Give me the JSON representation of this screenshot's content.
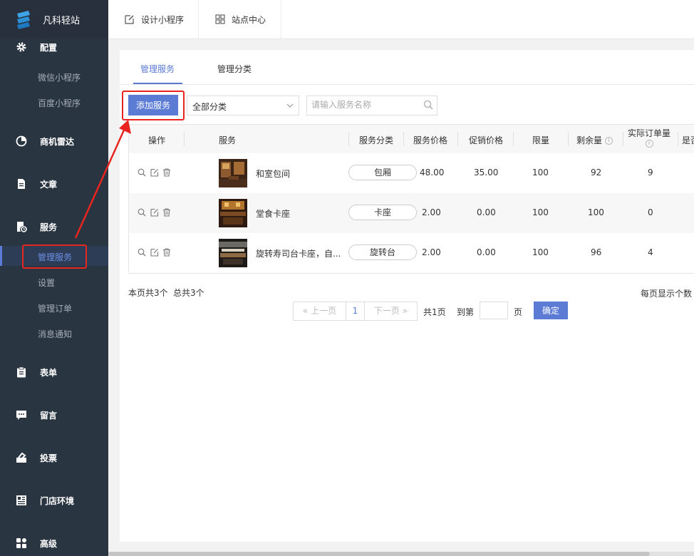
{
  "app": {
    "name": "凡科轻站"
  },
  "colors": {
    "sidebar_bg": "#2a3542",
    "accent": "#5b7bd5",
    "highlight": "#e8251f"
  },
  "sidebar": {
    "items": [
      {
        "label": "配置",
        "icon": "gear-icon"
      },
      {
        "label": "微信小程序"
      },
      {
        "label": "百度小程序"
      },
      {
        "label": "商机雷达",
        "icon": "radar-icon"
      },
      {
        "label": "文章",
        "icon": "document-icon"
      },
      {
        "label": "服务",
        "icon": "service-icon"
      },
      {
        "label": "管理服务",
        "active": true
      },
      {
        "label": "设置"
      },
      {
        "label": "管理订单"
      },
      {
        "label": "消息通知"
      },
      {
        "label": "表单",
        "icon": "clipboard-icon"
      },
      {
        "label": "留言",
        "icon": "message-icon"
      },
      {
        "label": "投票",
        "icon": "vote-icon"
      },
      {
        "label": "门店环境",
        "icon": "store-icon"
      },
      {
        "label": "高级",
        "icon": "grid-icon"
      }
    ]
  },
  "topbar": {
    "tabs": [
      {
        "label": "设计小程序",
        "icon": "edit-icon"
      },
      {
        "label": "站点中心",
        "icon": "apps-icon"
      }
    ]
  },
  "page": {
    "tabs": [
      {
        "label": "管理服务",
        "active": true
      },
      {
        "label": "管理分类"
      }
    ],
    "add_button": "添加服务",
    "category_filter": {
      "value": "全部分类"
    },
    "search": {
      "placeholder": "请输入服务名称"
    }
  },
  "table": {
    "headers": [
      "操作",
      "服务",
      "服务分类",
      "服务价格",
      "促销价格",
      "限量",
      "剩余量",
      "实际订单量",
      "是否"
    ],
    "rows": [
      {
        "name": "和室包间",
        "category": "包厢",
        "price": "48.00",
        "promo": "35.00",
        "limit": "100",
        "remain": "92",
        "orders": "9"
      },
      {
        "name": "堂食卡座",
        "category": "卡座",
        "price": "2.00",
        "promo": "0.00",
        "limit": "100",
        "remain": "100",
        "orders": "0"
      },
      {
        "name": "旋转寿司台卡座，自...",
        "category": "旋转台",
        "price": "2.00",
        "promo": "0.00",
        "limit": "100",
        "remain": "96",
        "orders": "4"
      }
    ]
  },
  "footer": {
    "page_count": "本页共3个",
    "total_count": "总共3个",
    "per_page_label": "每页显示个数",
    "prev": "上一页",
    "current_page": "1",
    "next": "下一页",
    "total_pages": "共1页",
    "goto_label": "到第",
    "page_unit": "页",
    "confirm": "确定"
  }
}
